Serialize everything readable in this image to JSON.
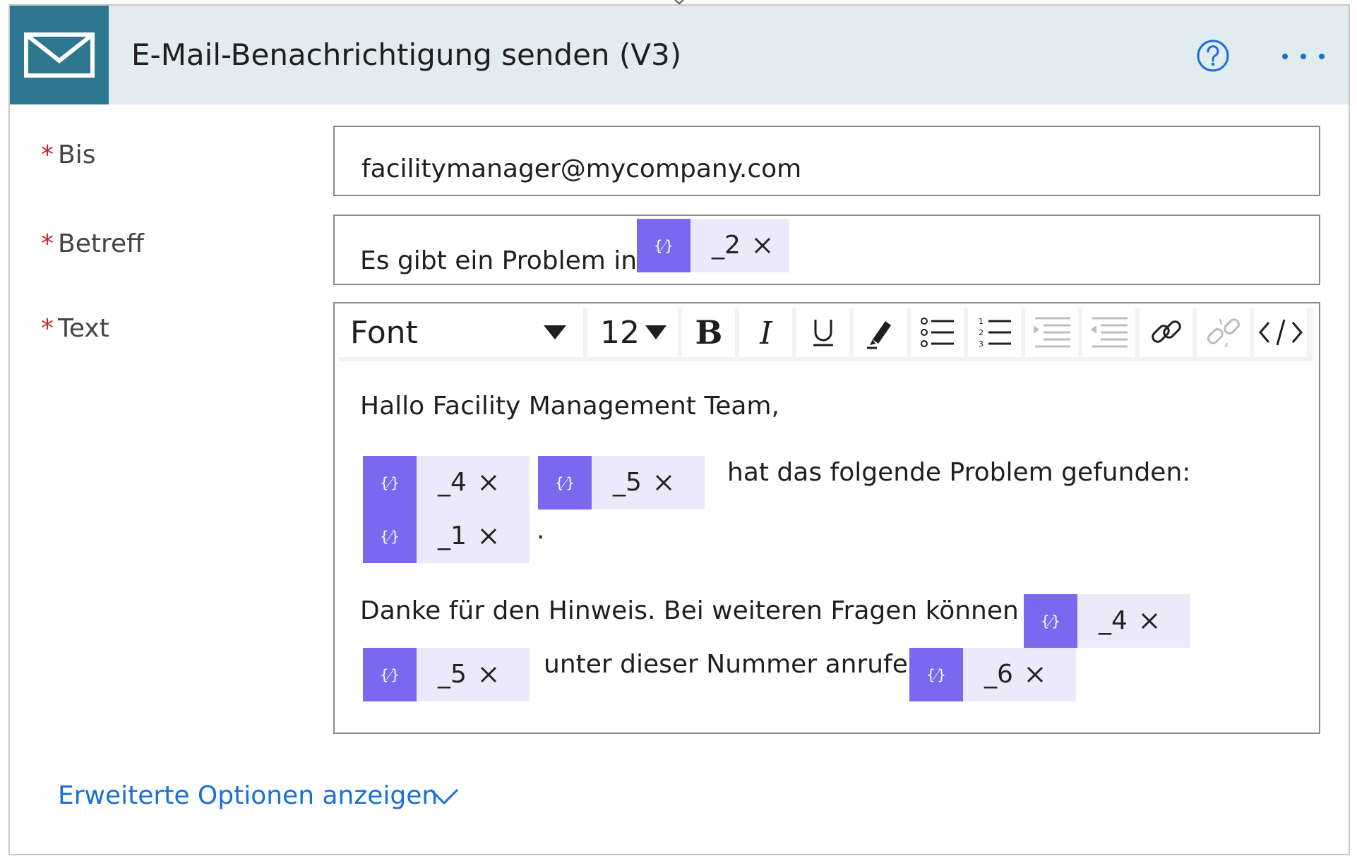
{
  "header": {
    "title": "E-Mail-Benachrichtigung senden (V3)",
    "icon": "mail-icon",
    "accent_color": "#2d7890",
    "background_color": "#e0ecef"
  },
  "fields": {
    "to": {
      "label": "Bis",
      "required_marker": "*",
      "value": "facilitymanager@mycompany.com"
    },
    "subject": {
      "label": "Betreff",
      "required_marker": "*",
      "text": "Es gibt ein Problem in",
      "token": "_2"
    },
    "body": {
      "label": "Text",
      "required_marker": "*"
    }
  },
  "toolbar": {
    "font_label": "Font",
    "size_label": "12",
    "buttons": [
      "bold-icon",
      "italic-icon",
      "underline-icon",
      "highlight-icon",
      "bullet-list-icon",
      "numbered-list-icon",
      "indent-icon",
      "outdent-icon",
      "link-icon",
      "unlink-icon",
      "code-view-icon"
    ]
  },
  "editor": {
    "greeting": "Hallo Facility Management Team,",
    "line2_text": "hat das folgende Problem gefunden:",
    "period": ".",
    "line4_text": "Danke für den Hinweis. Bei weiteren Fragen können Sie",
    "line5_text": "unter dieser Nummer anrufen:",
    "tokens": {
      "t1": "_4",
      "t2": "_5",
      "t3": "_1",
      "t4": "_4",
      "t5": "_5",
      "t6": "_6"
    },
    "token_color": "#7b68ee",
    "token_bg": "#ece9fb"
  },
  "footer": {
    "advanced_label": "Erweiterte Optionen anzeigen",
    "link_color": "#1a6fd6"
  }
}
